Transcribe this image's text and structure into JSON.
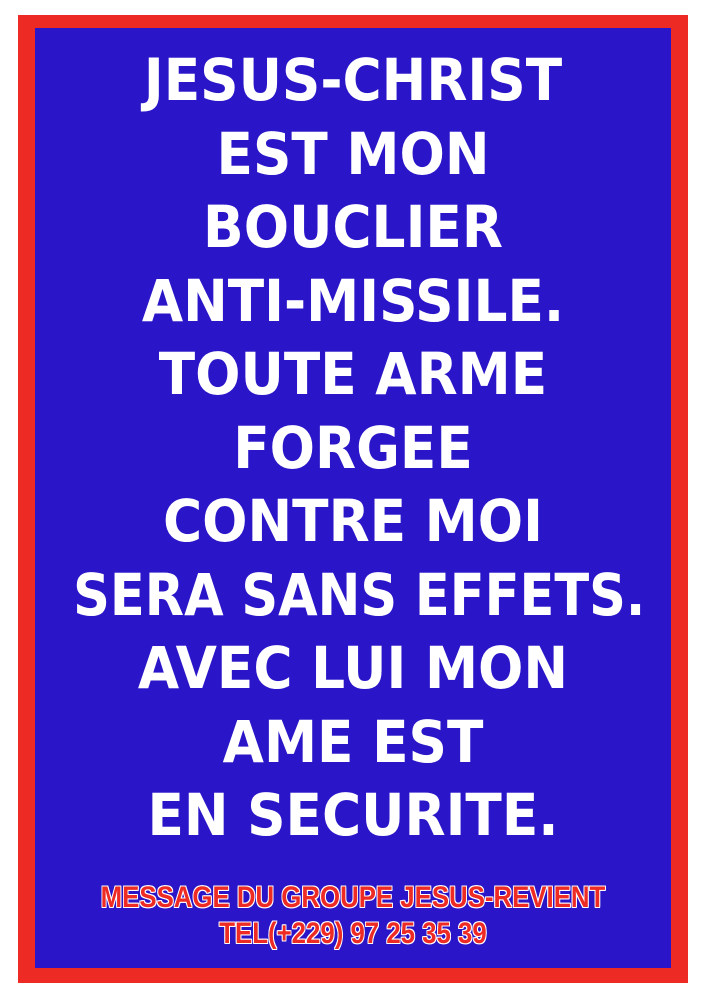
{
  "poster": {
    "lines": [
      "JESUS-CHRIST",
      "EST MON",
      "BOUCLIER",
      "ANTI-MISSILE.",
      "TOUTE ARME",
      "FORGEE",
      "CONTRE MOI",
      "SERA SANS EFFETS.",
      "AVEC LUI MON",
      "AME EST",
      "EN SECURITE."
    ],
    "footer_message": "MESSAGE DU GROUPE JESUS-REVIENT",
    "footer_phone": "TEL(+229) 97 25 35 39"
  },
  "colors": {
    "border": "#ee2a24",
    "background": "#2a16c8",
    "text": "#ffffff",
    "footer_text": "#ee2a24"
  }
}
